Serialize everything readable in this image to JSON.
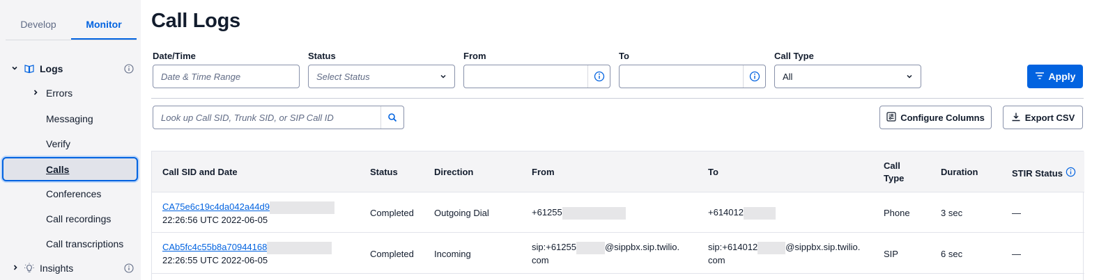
{
  "sidebar": {
    "tabs": [
      {
        "label": "Develop"
      },
      {
        "label": "Monitor"
      }
    ],
    "items": [
      {
        "label": "Logs"
      },
      {
        "label": "Errors"
      },
      {
        "label": "Messaging"
      },
      {
        "label": "Verify"
      },
      {
        "label": "Calls"
      },
      {
        "label": "Conferences"
      },
      {
        "label": "Call recordings"
      },
      {
        "label": "Call transcriptions"
      },
      {
        "label": "Insights"
      }
    ]
  },
  "main": {
    "title": "Call Logs",
    "filters": {
      "datetime": {
        "label": "Date/Time",
        "placeholder": "Date & Time Range"
      },
      "status": {
        "label": "Status",
        "placeholder": "Select Status"
      },
      "from": {
        "label": "From",
        "value": ""
      },
      "to": {
        "label": "To",
        "value": ""
      },
      "call_type": {
        "label": "Call Type",
        "value": "All"
      },
      "apply_label": "Apply"
    },
    "search": {
      "placeholder": "Look up Call SID, Trunk SID, or SIP Call ID"
    },
    "configure_columns_label": "Configure Columns",
    "export_csv_label": "Export CSV",
    "table": {
      "columns": [
        "Call SID and Date",
        "Status",
        "Direction",
        "From",
        "To",
        "Call",
        "Type",
        "Duration",
        "STIR Status"
      ],
      "rows": [
        {
          "sid": "CA75e6c19c4da042a44d9",
          "date": "22:26:56 UTC 2022-06-05",
          "status": "Completed",
          "direction": "Outgoing Dial",
          "from_a": "+61255",
          "from_b": "",
          "from_c": "",
          "to_a": "+614012",
          "to_b": "",
          "to_c": "",
          "call_type": "Phone",
          "duration": "3 sec",
          "stir": "—"
        },
        {
          "sid": "CAb5fc4c55b8a70944168",
          "date": "22:26:55 UTC 2022-06-05",
          "status": "Completed",
          "direction": "Incoming",
          "from_a": "sip:+61255",
          "from_b": "@sippbx.sip.twilio.",
          "from_c": "com",
          "to_a": "sip:+614012",
          "to_b": "@sippbx.sip.twilio.",
          "to_c": "com",
          "call_type": "SIP",
          "duration": "6 sec",
          "stir": "—"
        }
      ]
    }
  },
  "colors": {
    "accent": "#0263e0",
    "sidebar_bg": "#f4f4f6",
    "text": "#121c2d",
    "muted": "#606b85"
  },
  "icons": [
    "chevron-down-icon",
    "book-icon",
    "info-icon",
    "chevron-right-icon",
    "lightbulb-icon",
    "search-icon",
    "filter-icon",
    "columns-icon",
    "download-icon"
  ]
}
